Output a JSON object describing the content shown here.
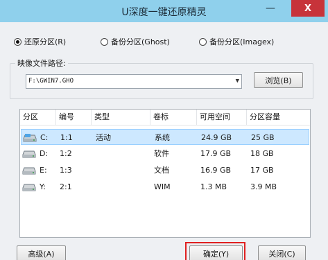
{
  "window": {
    "title": "U深度一键还原精灵",
    "minimize_glyph": "—",
    "close_glyph": "X"
  },
  "mode": {
    "options": [
      {
        "label": "还原分区(R)",
        "selected": true
      },
      {
        "label": "备份分区(Ghost)",
        "selected": false
      },
      {
        "label": "备份分区(Imagex)",
        "selected": false
      }
    ]
  },
  "image_path": {
    "label": "映像文件路径:",
    "value": "F:\\GWIN7.GHO",
    "browse_label": "浏览(B)"
  },
  "table": {
    "columns": [
      "分区",
      "编号",
      "类型",
      "卷标",
      "可用空间",
      "分区容量"
    ],
    "rows": [
      {
        "drive": "C:",
        "number": "1:1",
        "type": "活动",
        "label": "系统",
        "free": "24.9 GB",
        "capacity": "25 GB",
        "selected": true
      },
      {
        "drive": "D:",
        "number": "1:2",
        "type": "",
        "label": "软件",
        "free": "17.9 GB",
        "capacity": "18 GB",
        "selected": false
      },
      {
        "drive": "E:",
        "number": "1:3",
        "type": "",
        "label": "文档",
        "free": "16.9 GB",
        "capacity": "17 GB",
        "selected": false
      },
      {
        "drive": "Y:",
        "number": "2:1",
        "type": "",
        "label": "WIM",
        "free": "1.3 MB",
        "capacity": "3.9 MB",
        "selected": false
      }
    ]
  },
  "footer": {
    "advanced_label": "高级(A)",
    "ok_label": "确定(Y)",
    "close_label": "关闭(C)"
  },
  "colors": {
    "title_bar": "#8fd0ec",
    "close_button": "#c7333a",
    "selected_row": "#cde8ff",
    "highlight_box": "#e02020"
  }
}
